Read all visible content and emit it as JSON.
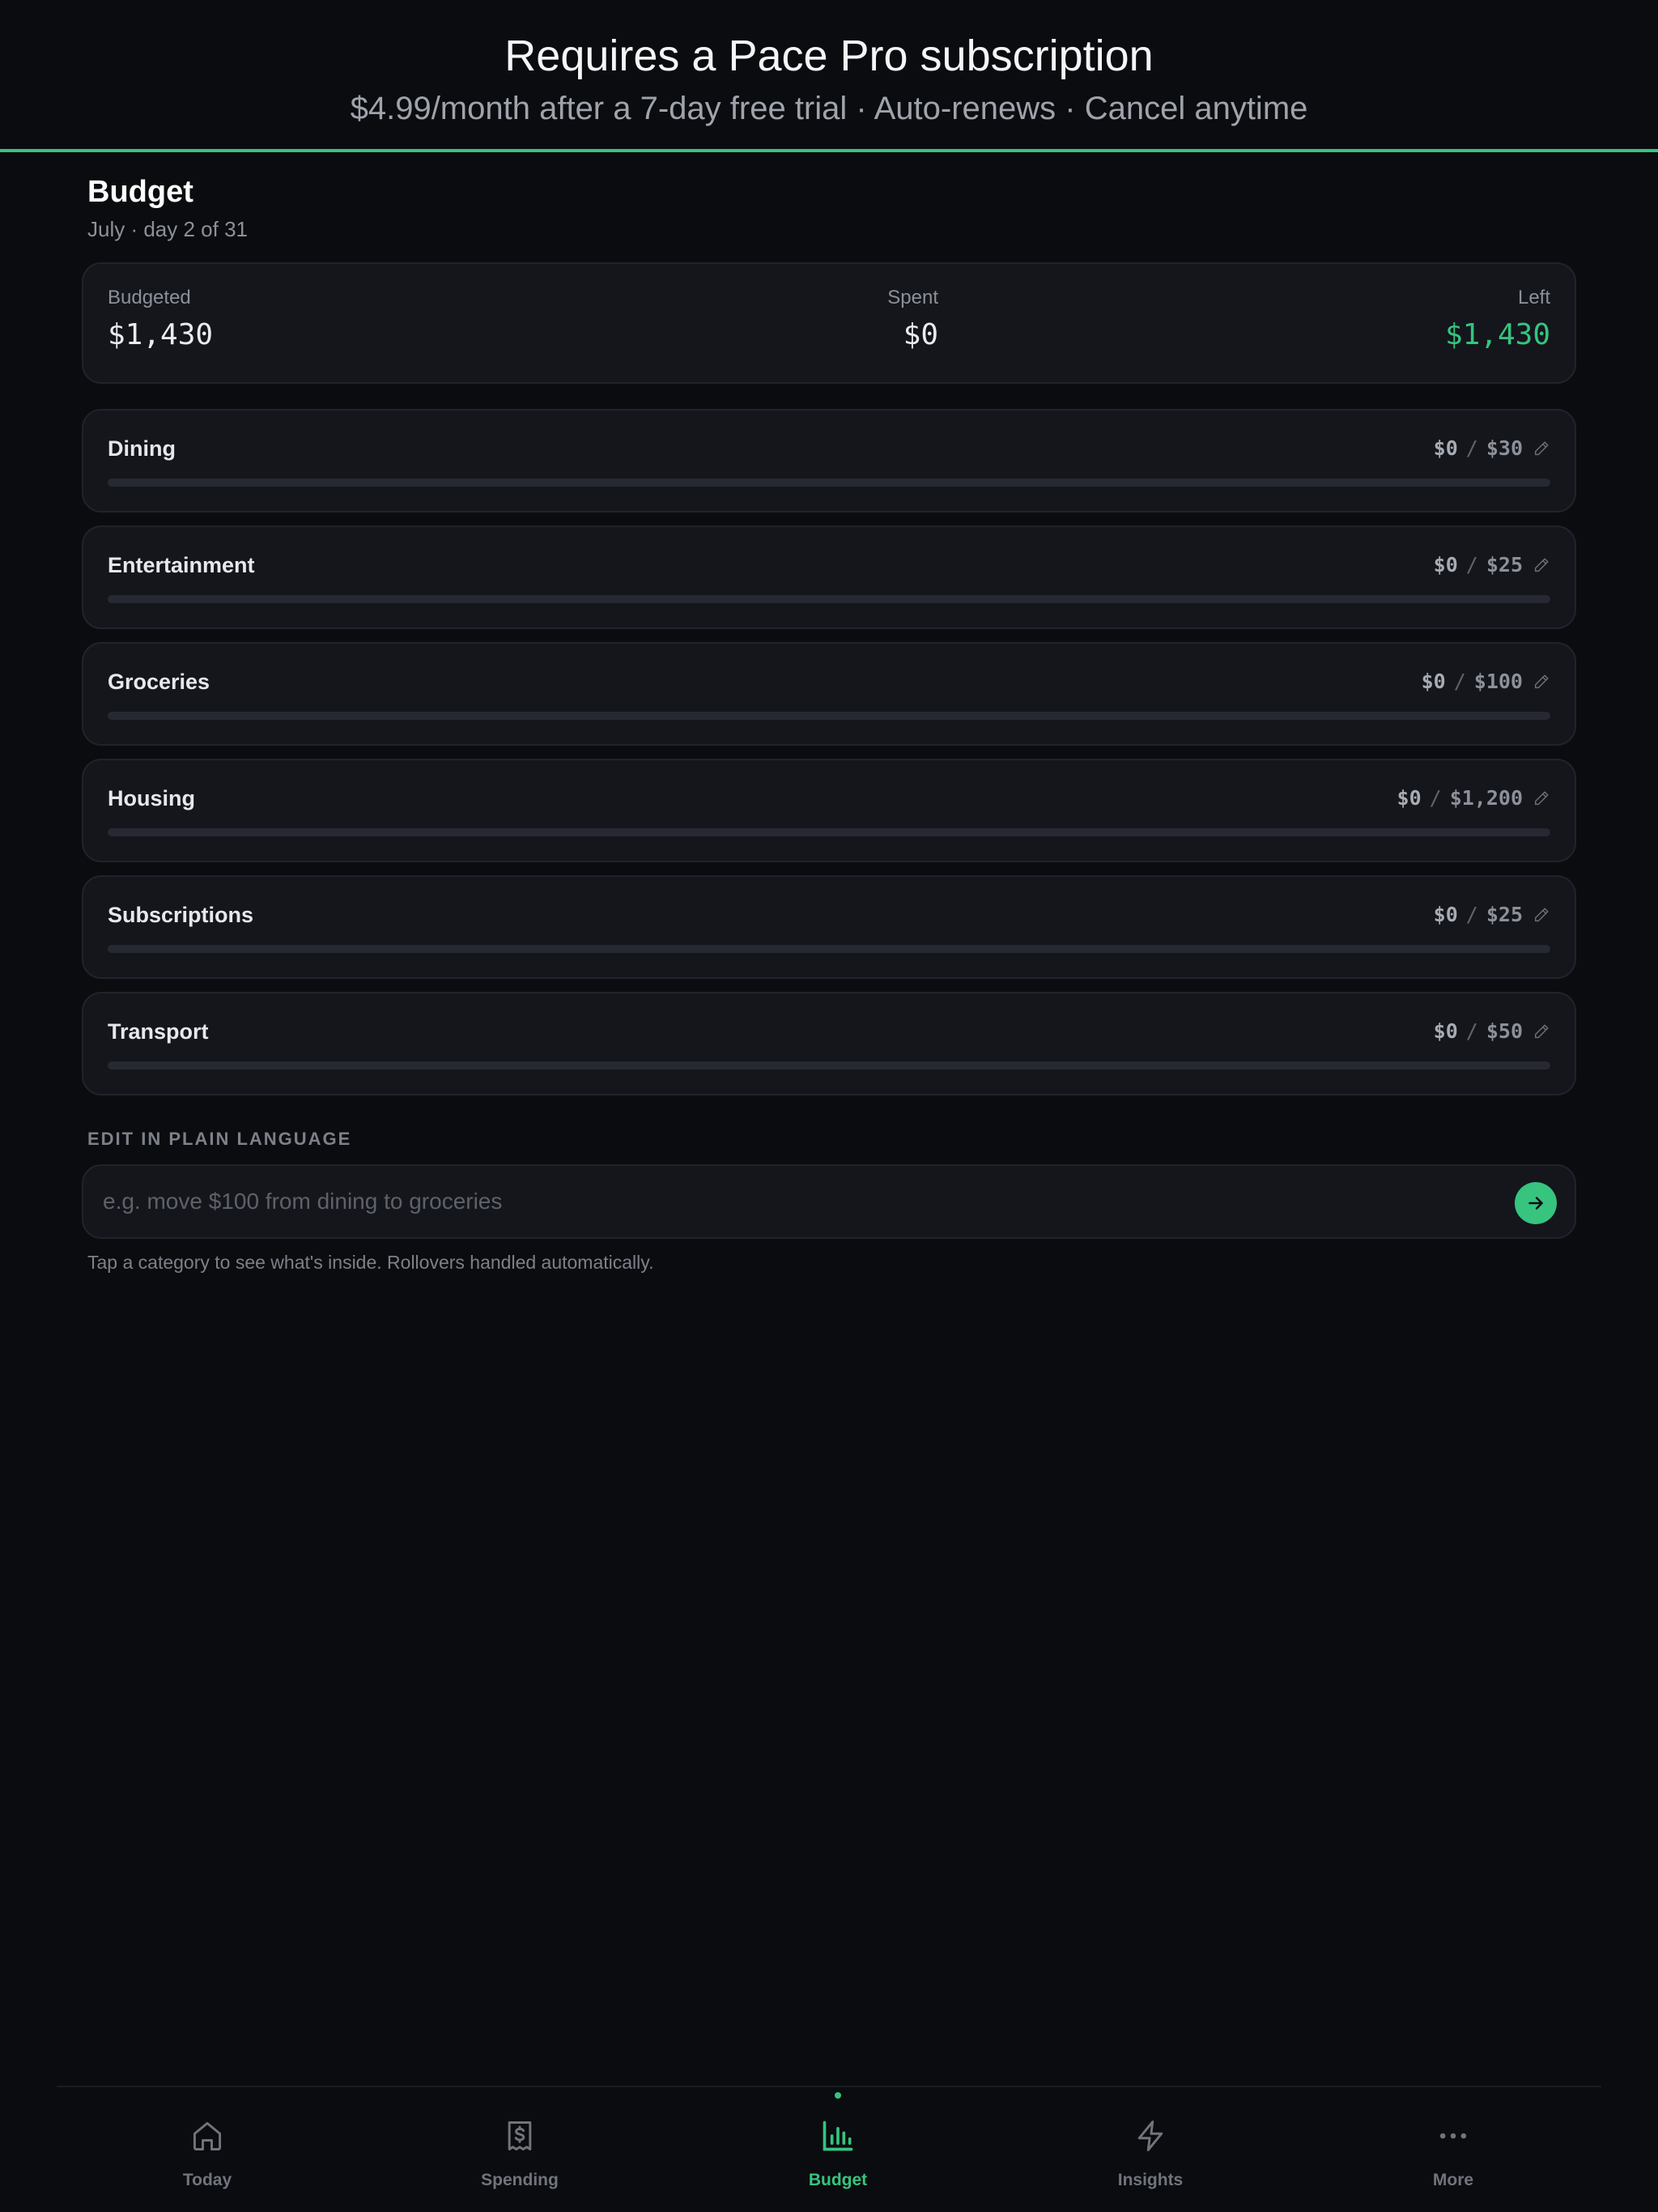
{
  "banner": {
    "title": "Requires a Pace Pro subscription",
    "subtitle": "$4.99/month after a 7-day free trial · Auto-renews · Cancel anytime"
  },
  "header": {
    "title": "Budget",
    "subtitle": "July · day 2 of 31"
  },
  "summary": {
    "budgeted_label": "Budgeted",
    "budgeted_value": "$1,430",
    "spent_label": "Spent",
    "spent_value": "$0",
    "left_label": "Left",
    "left_value": "$1,430"
  },
  "categories": [
    {
      "name": "Dining",
      "spent": "$0",
      "separator": "/",
      "limit": "$30",
      "progress": 0,
      "edit_icon": "pencil-icon"
    },
    {
      "name": "Entertainment",
      "spent": "$0",
      "separator": "/",
      "limit": "$25",
      "progress": 0,
      "edit_icon": "pencil-icon"
    },
    {
      "name": "Groceries",
      "spent": "$0",
      "separator": "/",
      "limit": "$100",
      "progress": 0,
      "edit_icon": "pencil-icon"
    },
    {
      "name": "Housing",
      "spent": "$0",
      "separator": "/",
      "limit": "$1,200",
      "progress": 0,
      "edit_icon": "pencil-icon"
    },
    {
      "name": "Subscriptions",
      "spent": "$0",
      "separator": "/",
      "limit": "$25",
      "progress": 0,
      "edit_icon": "pencil-icon"
    },
    {
      "name": "Transport",
      "spent": "$0",
      "separator": "/",
      "limit": "$50",
      "progress": 0,
      "edit_icon": "pencil-icon"
    }
  ],
  "edit": {
    "section_label": "EDIT IN PLAIN LANGUAGE",
    "input_value": "",
    "input_placeholder": "e.g. move $100 from dining to groceries",
    "send_icon": "arrow-right-icon",
    "hint": "Tap a category to see what's inside. Rollovers handled automatically."
  },
  "tabbar": {
    "active": "budget",
    "tabs": [
      {
        "id": "today",
        "label": "Today",
        "icon": "home-icon"
      },
      {
        "id": "spending",
        "label": "Spending",
        "icon": "receipt-dollar-icon"
      },
      {
        "id": "budget",
        "label": "Budget",
        "icon": "bar-chart-icon"
      },
      {
        "id": "insights",
        "label": "Insights",
        "icon": "lightning-icon"
      },
      {
        "id": "more",
        "label": "More",
        "icon": "more-dots-icon"
      }
    ]
  },
  "colors": {
    "accent": "#36c47f",
    "background": "#0b0c0f",
    "card": "#14161c",
    "muted_text": "#8c9099"
  }
}
